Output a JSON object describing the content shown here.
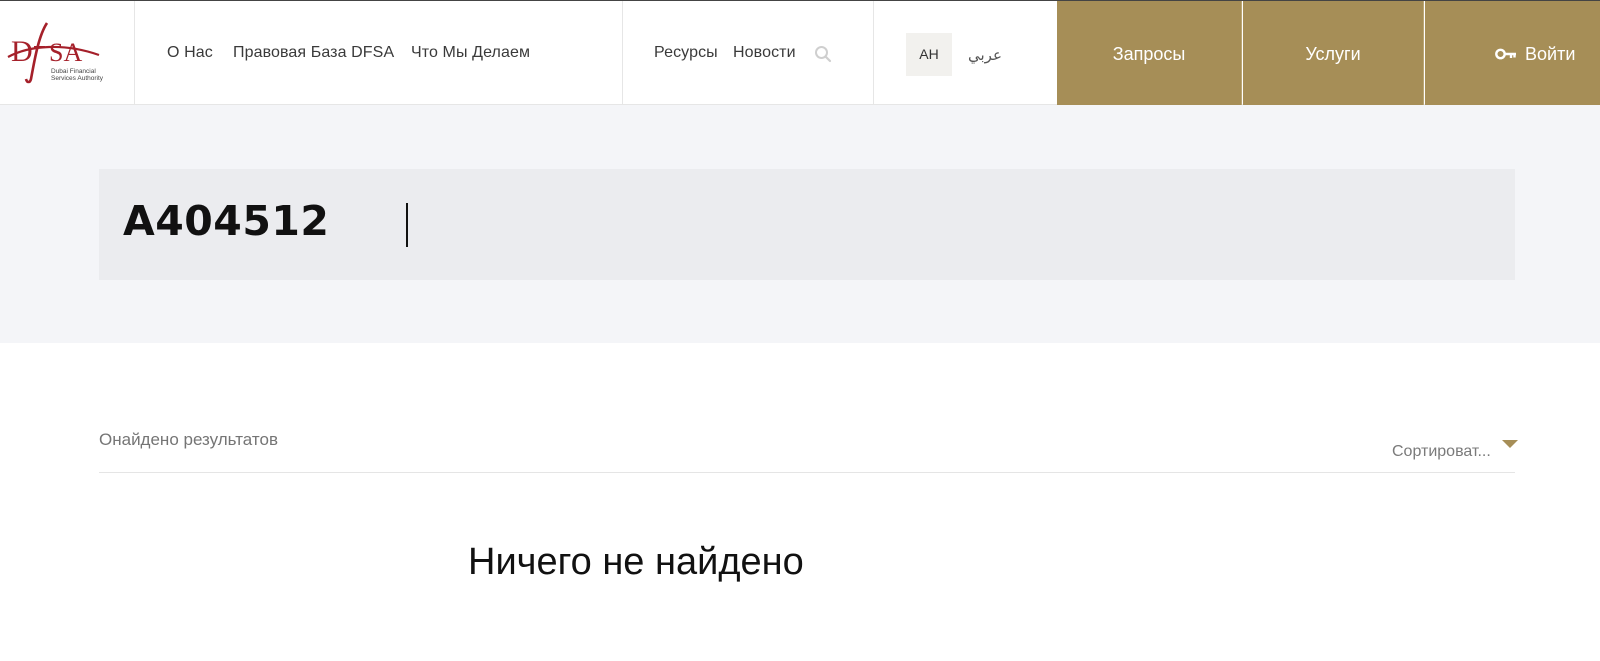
{
  "header": {
    "logo": {
      "letters": "DFSA",
      "text_line1": "Dubai Financial",
      "text_line2": "Services Authority"
    },
    "nav": {
      "about": "О Нас",
      "legal_base": "Правовая База DFSA",
      "what_we_do": "Что Мы Делаем",
      "resources": "Ресурсы",
      "news": "Новости"
    },
    "search_icon": "search-icon",
    "language": {
      "current": "АН",
      "alternate": "عربي"
    },
    "actions": {
      "requests": "Запросы",
      "services": "Услуги",
      "login": "Войти",
      "login_icon": "key-icon"
    },
    "colors": {
      "accent_gold": "#a68e57",
      "logo_red": "#a5202a"
    }
  },
  "search": {
    "query": "A404512"
  },
  "results": {
    "count_text": "Онайдено результатов",
    "sort_label": "Сортироват...",
    "empty_message": "Ничего не найдено"
  }
}
